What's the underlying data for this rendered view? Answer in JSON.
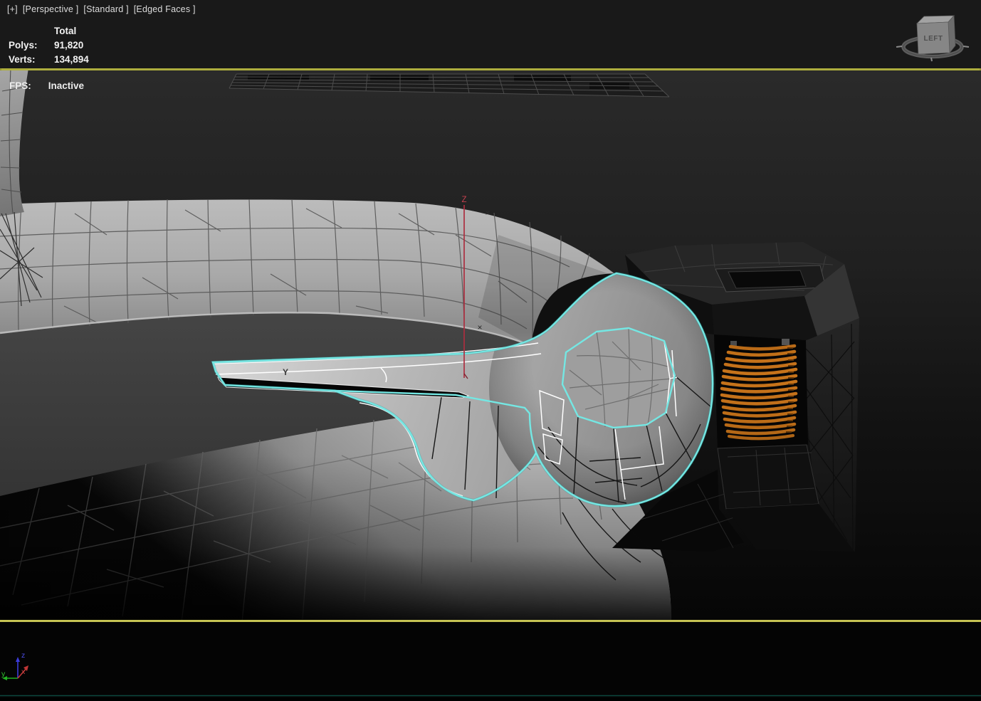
{
  "viewport_header": {
    "label": {
      "general_menu": "[+]",
      "pov_menu": "[Perspective ]",
      "shading_quality": "[Standard ]",
      "shading_style": "[Edged Faces ]"
    },
    "statistics": {
      "total_header": "Total",
      "polys_label": "Polys:",
      "polys_total": "91,820",
      "verts_label": "Verts:",
      "verts_total": "134,894"
    }
  },
  "viewport": {
    "fps_label": "FPS:",
    "fps_value": "Inactive"
  },
  "viewcube": {
    "face_label": "LEFT"
  },
  "transform_gizmo": {
    "z_axis_label": "Z",
    "y_axis_label": "Y",
    "x_marker_upper": "×",
    "x_marker_lower": "×"
  },
  "world_axis_tripod": {
    "x_label": "x",
    "y_label": "y",
    "z_label": "z"
  },
  "colors": {
    "selection_cyan": "#74e7e3",
    "spring_orange": "#c4711b",
    "gizmo_red": "#ad2e3f",
    "active_border_yellow": "#b5b43f",
    "axis_x_red": "#d04343",
    "axis_y_green": "#2fbf2f",
    "axis_z_blue": "#4d4de8"
  }
}
